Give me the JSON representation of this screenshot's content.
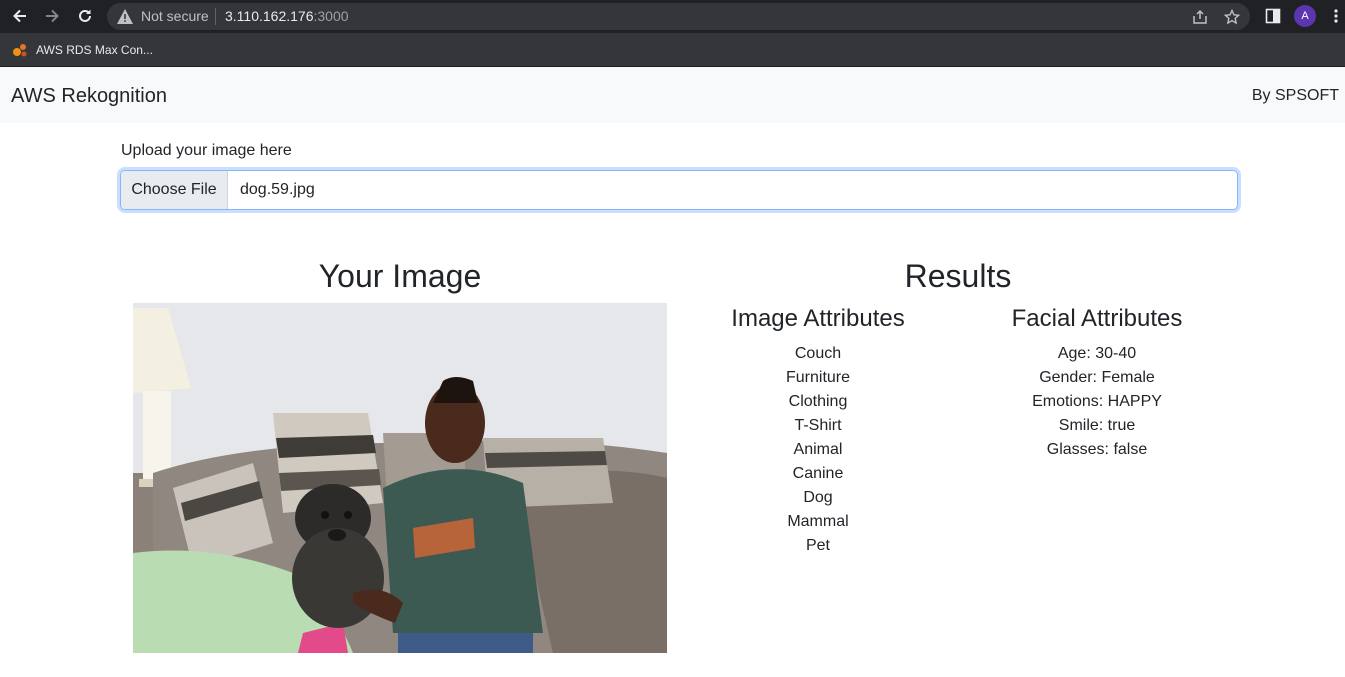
{
  "browser": {
    "security_status": "Not secure",
    "url_host": "3.110.162.176",
    "url_port": ":3000",
    "profile_initial": "A",
    "bookmark_label": "AWS RDS Max Con..."
  },
  "app": {
    "brand": "AWS Rekognition",
    "byline": "By SPSOFT"
  },
  "upload": {
    "label": "Upload your image here",
    "button_label": "Choose File",
    "file_name": "dog.59.jpg"
  },
  "image_section": {
    "heading": "Your Image"
  },
  "results": {
    "heading": "Results",
    "image_attributes": {
      "heading": "Image Attributes",
      "items": [
        "Couch",
        "Furniture",
        "Clothing",
        "T-Shirt",
        "Animal",
        "Canine",
        "Dog",
        "Mammal",
        "Pet"
      ]
    },
    "facial_attributes": {
      "heading": "Facial Attributes",
      "items": [
        "Age: 30-40",
        "Gender: Female",
        "Emotions: HAPPY",
        "Smile: true",
        "Glasses: false"
      ]
    }
  },
  "colors": {
    "chrome_dark": "#202124",
    "omnibox": "#35363a",
    "navbar_bg": "#f8f9fa",
    "text": "#212529",
    "focus_border": "#86b7fe",
    "avatar": "#5e35b1"
  }
}
